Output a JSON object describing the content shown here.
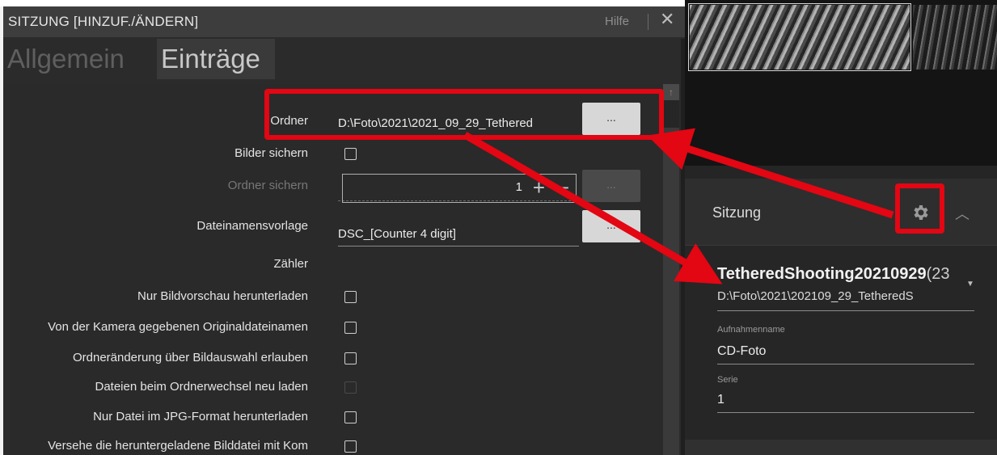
{
  "dialog": {
    "title": "SITZUNG [HINZUF./ÄNDERN]",
    "help": "Hilfe",
    "close": "✕",
    "tabs": [
      {
        "label": "Allgemein",
        "active": false
      },
      {
        "label": "Einträge",
        "active": true
      }
    ]
  },
  "form": {
    "folder_label": "Ordner",
    "folder_value": "D:\\Foto\\2021\\2021_09_29_Tethered",
    "browse": "...",
    "save_images_label": "Bilder sichern",
    "save_folder_label": "Ordner sichern",
    "filename_template_label": "Dateinamensvorlage",
    "filename_template_value": "DSC_[Counter 4 digit]",
    "counter_label": "Zähler",
    "counter_value": "1",
    "counter_plus": "+",
    "counter_minus": "−",
    "options": [
      {
        "label": "Nur Bildvorschau herunterladen",
        "enabled": true
      },
      {
        "label": "Von der Kamera gegebenen Originaldateinamen",
        "enabled": true
      },
      {
        "label": "Ordneränderung über Bildauswahl erlauben",
        "enabled": true
      },
      {
        "label": "Dateien beim Ordnerwechsel neu laden",
        "enabled": false
      },
      {
        "label": "Nur Datei im JPG-Format herunterladen",
        "enabled": true
      },
      {
        "label": "Versehe die heruntergeladene Bilddatei mit Kom",
        "enabled": true
      }
    ]
  },
  "session_panel": {
    "title": "Sitzung",
    "gear_icon": "gear-icon",
    "collapse_icon": "chevron-up-icon",
    "session_name": "TetheredShooting20210929",
    "session_count": "(23",
    "session_path": "D:\\Foto\\2021\\202109_29_TetheredS",
    "shot_name_label": "Aufnahmenname",
    "shot_name_value": "CD-Foto",
    "series_label": "Serie",
    "series_value": "1"
  },
  "colors": {
    "annotation_red": "#e30613",
    "dialog_bg": "#2b2b2b",
    "titlebar_bg": "#3d3d3d"
  }
}
